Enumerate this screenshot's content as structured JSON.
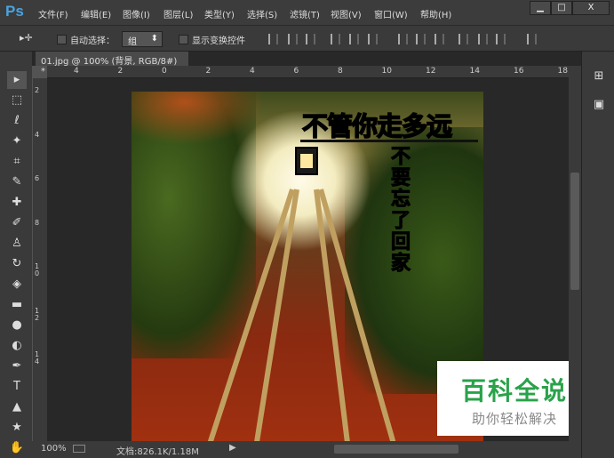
{
  "app": {
    "logo": "Ps"
  },
  "menu": [
    "文件(F)",
    "编辑(E)",
    "图像(I)",
    "图层(L)",
    "类型(Y)",
    "选择(S)",
    "滤镜(T)",
    "视图(V)",
    "窗口(W)",
    "帮助(H)"
  ],
  "window_controls": {
    "minimize": "▁",
    "maximize": "□",
    "close": "X"
  },
  "options": {
    "move_tool": "▸✛",
    "auto_select_label": "自动选择：",
    "auto_select_value": "组",
    "show_transform_label": "显示变换控件"
  },
  "document_tab": {
    "title": "01.jpg @ 100% (背景, RGB/8#) *",
    "close": "×"
  },
  "ruler_top": [
    "4",
    "2",
    "0",
    "2",
    "4",
    "6",
    "8",
    "10",
    "12",
    "14",
    "16",
    "18"
  ],
  "ruler_left": [
    "2",
    "4",
    "6",
    "8",
    "1 0",
    "1 2",
    "1 4"
  ],
  "tools": [
    "move",
    "marquee",
    "lasso",
    "magic-wand",
    "crop",
    "eyedropper",
    "healing",
    "brush",
    "stamp",
    "history-brush",
    "eraser",
    "gradient",
    "blur",
    "dodge",
    "pen",
    "type",
    "path-select",
    "shape",
    "hand"
  ],
  "tool_glyphs": [
    "▸",
    "⬚",
    "ℓ",
    "✦",
    "⌗",
    "✎",
    "✚",
    "✐",
    "♙",
    "↻",
    "◈",
    "▬",
    "●",
    "◐",
    "✒",
    "T",
    "▲",
    "★",
    "✋"
  ],
  "image_text": {
    "title": "不管你走多远",
    "vertical": "不要忘了回家"
  },
  "watermark": {
    "brand": "百科全说",
    "slogan": "助你轻松解决"
  },
  "status": {
    "zoom": "100%",
    "doc_size": "文档:826.1K/1.18M"
  },
  "panel_icons": [
    "history",
    "properties"
  ]
}
